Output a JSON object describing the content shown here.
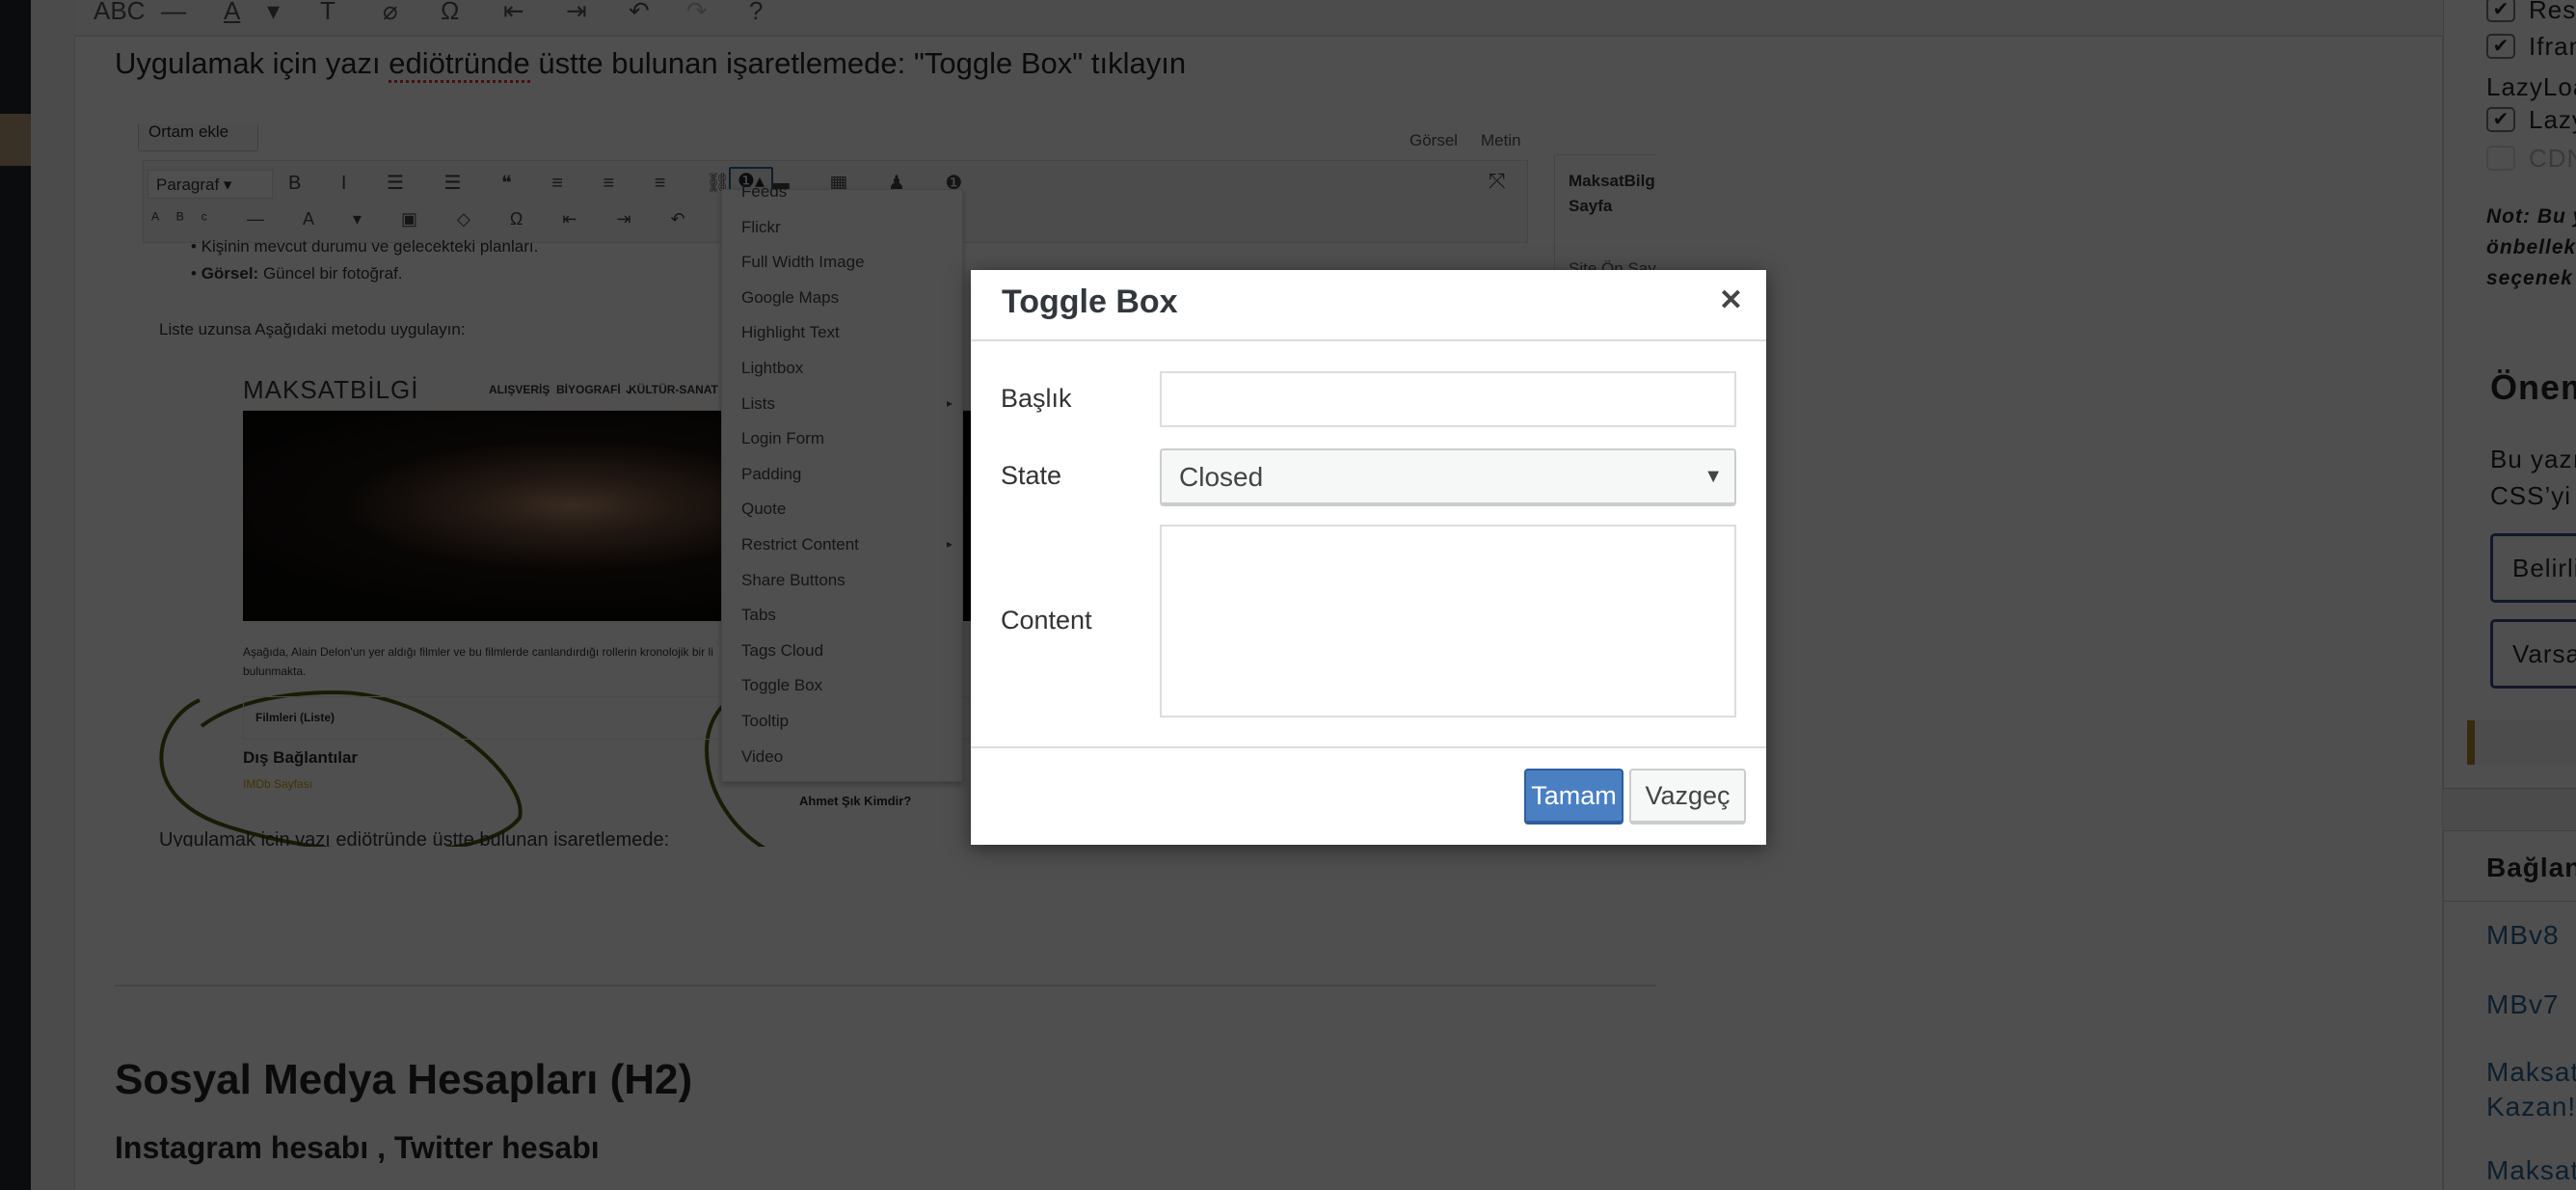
{
  "editor_intro": "Uygulamak için yazı ediötründe üstte bulunan işaretlemede:  \"Toggle Box\" tıklayın",
  "spell_word": "ediötründe",
  "toolbar_glyphs": [
    "ABC",
    "—",
    "A",
    "▾",
    "T",
    "⌀",
    "Ω",
    "⇤",
    "⇥",
    "↶",
    "↷",
    "?"
  ],
  "embedded": {
    "add_media": "Ortam ekle",
    "tab_visual": "Görsel",
    "tab_text": "Metin",
    "format_select": "Paragraf",
    "bullet1": "Kişinin mevcut durumu ve gelecekteki planları.",
    "bullet2_bold": "Görsel:",
    "bullet2": " Güncel bir fotoğraf.",
    "list_note": "Liste uzunsa Aşağıdaki metodu uygulayın:",
    "site_logo": "MAKSATBİLGİ",
    "site_nav": [
      "ALIŞVERİŞ",
      "BİYOGRAFİ ⌄",
      "KÜLTÜR-SANAT"
    ],
    "paragraph": "Aşağıda, Alain Delon'un yer aldığı filmler ve bu filmlerde canlandırdığı rollerin kronolojik bir li",
    "paragraph2": "bulunmakta.",
    "toggle_title": "Filmleri (Liste)",
    "external_links": "Dış Bağlantılar",
    "imdb": "IMDb Sayfası",
    "side_post": "Ahmet Şık Kimdir?",
    "bottom_text": "Uygulamak icin vazı ediötründe üstte bulunan isaretlemede:",
    "side_box_title": "MaksatBilgi Sayfa",
    "side_box_item": "Site Ön Sayfa"
  },
  "shortcode_menu": [
    "Feeds",
    "Flickr",
    "Full Width Image",
    "Google Maps",
    "Highlight Text",
    "Lightbox",
    "Lists",
    "Login Form",
    "Padding",
    "Quote",
    "Restrict Content",
    "Share Buttons",
    "Tabs",
    "Tags Cloud",
    "Toggle Box",
    "Tooltip",
    "Video"
  ],
  "submenu_items": [
    "Lists",
    "Restrict Content"
  ],
  "headings": {
    "h2": "Sosyal Medya Hesapları (H2)",
    "h3": "Instagram hesabı , Twitter hesabı"
  },
  "sidebar": {
    "options": [
      {
        "label": "Resi",
        "checked": true
      },
      {
        "label": "Ifran",
        "checked": true
      },
      {
        "label": "LazyLoa",
        "heading": true
      },
      {
        "label": "Lazy",
        "checked": true
      },
      {
        "label": "CDN",
        "checked": false
      }
    ],
    "note": [
      "Not: Bu y",
      "önbellek",
      "seçenek"
    ],
    "important_title": "Önem",
    "important_text": [
      "Bu yazı",
      "CSS’yi c"
    ],
    "buttons": [
      "Belirli",
      "Varsa"
    ],
    "links_title": "Bağlantı",
    "links": [
      "MBv8",
      "MBv7",
      "MaksatBi",
      "Kazan!",
      "MaksatR"
    ]
  },
  "dialog": {
    "title": "Toggle Box",
    "close": "✕",
    "title_label": "Başlık",
    "title_value": "",
    "state_label": "State",
    "state_value": "Closed",
    "content_label": "Content",
    "content_value": "",
    "ok": "Tamam",
    "cancel": "Vazgeç"
  },
  "colors": {
    "primary": "#4a80c2",
    "link": "#2a6496",
    "annotation": "#4a5a10",
    "accent_bar": "#b08a2e"
  }
}
